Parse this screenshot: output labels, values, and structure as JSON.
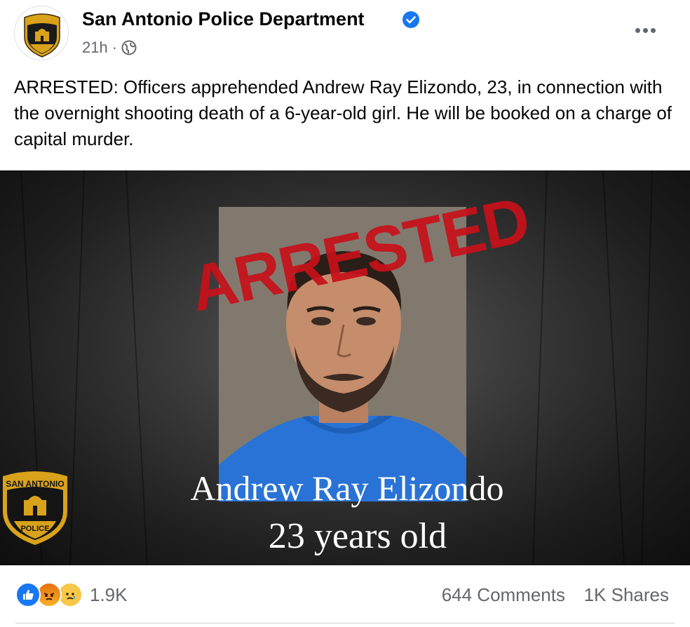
{
  "post": {
    "page_name": "San Antonio Police Department",
    "verified": true,
    "time": "21h",
    "separator": "·",
    "audience_icon": "globe-icon",
    "more_icon": "more-options-icon",
    "text": "ARRESTED: Officers apprehended Andrew Ray Elizondo, 23, in connection with the overnight shooting death of a 6-year-old girl. He will be booked on a charge of capital murder.",
    "avatar": {
      "logo_top": "SAN ANTONIO",
      "logo_bottom": "POLICE"
    }
  },
  "image": {
    "stamp_text": "ARRESTED",
    "name": "Andrew Ray Elizondo",
    "age_line": "23 years old",
    "badge_top": "SAN ANTONIO",
    "badge_bottom": "POLICE"
  },
  "stats": {
    "reaction_icons": [
      "like-icon",
      "angry-icon",
      "sad-icon"
    ],
    "reaction_count": "1.9K",
    "comments": "644 Comments",
    "shares": "1K Shares"
  },
  "colors": {
    "facebook_blue": "#1877f2",
    "secondary_text": "#65676b",
    "stamp_red": "#c8101a",
    "badge_gold": "#d9a21b"
  }
}
